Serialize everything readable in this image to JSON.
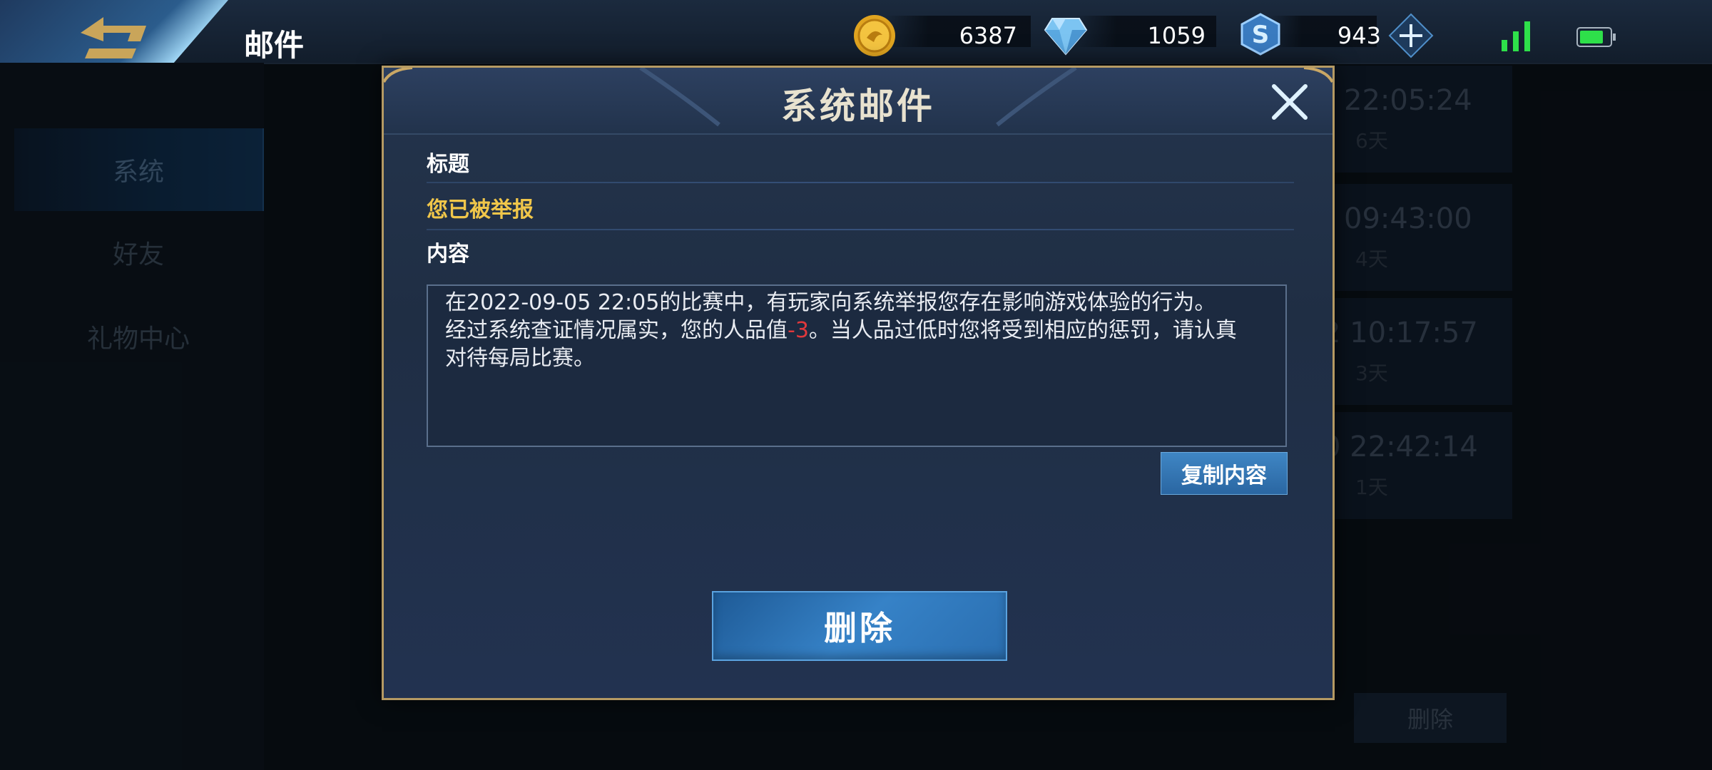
{
  "header": {
    "title": "邮件",
    "gold": "6387",
    "diamonds": "1059",
    "tokens": "943"
  },
  "sidebar": {
    "items": [
      {
        "label": "系统"
      },
      {
        "label": "好友"
      },
      {
        "label": "礼物中心"
      }
    ]
  },
  "mail_list": [
    {
      "time": "22:05:24",
      "age": "6天"
    },
    {
      "time": "09:43:00",
      "age": "4天"
    },
    {
      "time": "2 10:17:57",
      "age": "3天"
    },
    {
      "time": "0 22:42:14",
      "age": "1天"
    }
  ],
  "background_delete_label": "删除",
  "modal": {
    "title": "系统邮件",
    "subject_label": "标题",
    "subject": "您已被举报",
    "content_label": "内容",
    "body_line1": "在2022-09-05 22:05的比赛中，有玩家向系统举报您存在影响游戏体验的行为。",
    "body_line2_prefix": "经过系统查证情况属实，您的人品值",
    "body_penalty": "-3",
    "body_line2_suffix": "。当人品过低时您将受到相应的惩罚，请认真",
    "body_line3": "对待每局比赛。",
    "copy_label": "复制内容",
    "delete_label": "删除"
  },
  "colors": {
    "frame_gold": "#b59a63",
    "subject_yellow": "#f0c64a",
    "penalty_red": "#e0383c",
    "button_blue": "#3682c7"
  },
  "icons": [
    "back-arrow-icon",
    "gold-coin-icon",
    "diamond-icon",
    "token-icon",
    "add-icon",
    "signal-icon",
    "battery-icon",
    "close-icon"
  ]
}
